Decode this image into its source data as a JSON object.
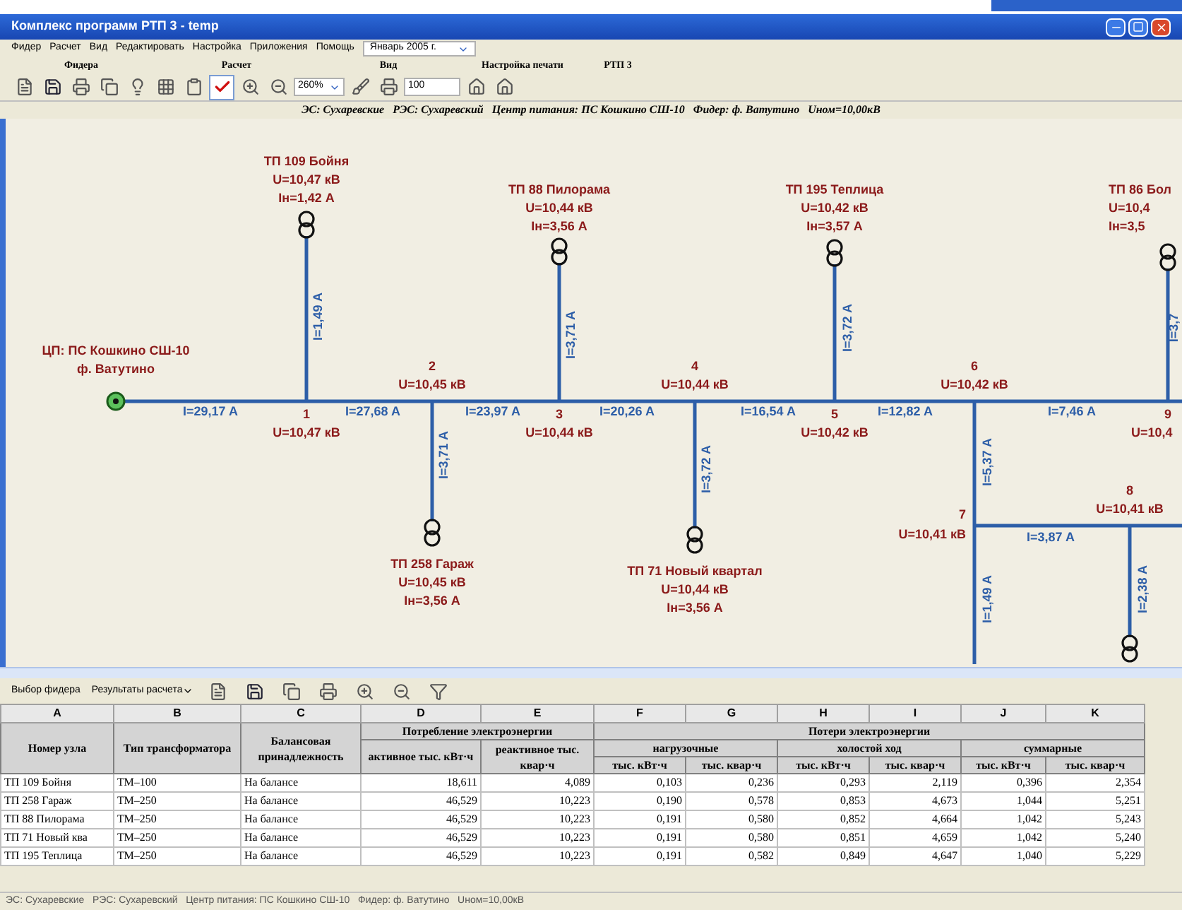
{
  "window": {
    "title": "Комплекс программ РТП 3 - temp"
  },
  "menu": [
    "Фидер",
    "Расчет",
    "Вид",
    "Редактировать",
    "Настройка",
    "Приложения",
    "Помощь"
  ],
  "period_select": "Январь 2005 г.",
  "toolbar_groups": [
    "Фидера",
    "Расчет",
    "Вид",
    "Настройка печати",
    "РТП 3"
  ],
  "zoom_select": "260%",
  "print_copies": "100",
  "info_bar": "ЭС: Сухаревские   РЭС: Сухаревский   Центр питания: ПС Кошкино СШ-10   Фидер: ф. Ватутино   Uном=10,00кВ",
  "diagram": {
    "source": [
      "ЦП: ПС Кошкино СШ-10",
      "ф. Ватутино"
    ],
    "transformers": [
      {
        "name": "ТП 109 Бойня",
        "voltage": "U=10,47 кВ",
        "current": "Iн=1,42 А"
      },
      {
        "name": "ТП 258 Гараж",
        "voltage": "U=10,45 кВ",
        "current": "Iн=3,56 А"
      },
      {
        "name": "ТП 88 Пилорама",
        "voltage": "U=10,44 кВ",
        "current": "Iн=3,56 А"
      },
      {
        "name": "ТП 71 Новый квартал",
        "voltage": "U=10,44 кВ",
        "current": "Iн=3,56 А"
      },
      {
        "name": "ТП 195 Теплица",
        "voltage": "U=10,42 кВ",
        "current": "Iн=3,57 А"
      },
      {
        "name": "ТП 86 Бол",
        "voltage": "U=10,4",
        "current": "Iн=3,5"
      }
    ],
    "nodes": [
      {
        "number": "1",
        "voltage": "U=10,47 кВ"
      },
      {
        "number": "2",
        "voltage": "U=10,45 кВ"
      },
      {
        "number": "3",
        "voltage": "U=10,44 кВ"
      },
      {
        "number": "4",
        "voltage": "U=10,44 кВ"
      },
      {
        "number": "5",
        "voltage": "U=10,42 кВ"
      },
      {
        "number": "6",
        "voltage": "U=10,42 кВ"
      },
      {
        "number": "9",
        "voltage": "U=10,4"
      },
      {
        "number": "8",
        "voltage": "U=10,41 кВ"
      },
      {
        "number": "7",
        "voltage": "U=10,41 кВ"
      }
    ],
    "currents": [
      "I=29,17 A",
      "I=1,49 A",
      "I=27,68 A",
      "I=3,71 A",
      "I=3,71 A",
      "I=23,97 A",
      "I=20,26 A",
      "I=3,72 A",
      "I=16,54 A",
      "I=3,72 A",
      "I=12,82 A",
      "I=5,37 A",
      "I=7,46 A",
      "I=3,7",
      "I=3,87 A",
      "I=1,49 A",
      "I=2,38 A"
    ]
  },
  "results_toolbar": {
    "feeder_button": "Выбор фидера",
    "results_menu": "Результаты расчета"
  },
  "table": {
    "column_letters": [
      "A",
      "B",
      "C",
      "D",
      "E",
      "F",
      "G",
      "H",
      "I",
      "J",
      "K"
    ],
    "headers": {
      "node": "Номер узла",
      "type": "Тип трансформатора",
      "balance": "Балансовая принадлежность",
      "consumption": "Потребление электроэнергии",
      "losses": "Потери электроэнергии",
      "active": "активное тыс. кВт·ч",
      "reactive": "реактивное тыс. квар·ч",
      "loss_groups": [
        "нагрузочные",
        "холостой ход",
        "суммарные"
      ],
      "units": [
        "тыс. кВт·ч",
        "тыс. квар·ч",
        "тыс. кВт·ч",
        "тыс. квар·ч",
        "тыс. кВт·ч",
        "тыс. квар·ч"
      ]
    },
    "rows": [
      [
        "ТП 109 Бойня",
        "ТМ–100",
        "На балансе",
        "18,611",
        "4,089",
        "0,103",
        "0,236",
        "0,293",
        "2,119",
        "0,396",
        "2,354"
      ],
      [
        "ТП 258 Гараж",
        "ТМ–250",
        "На балансе",
        "46,529",
        "10,223",
        "0,190",
        "0,578",
        "0,853",
        "4,673",
        "1,044",
        "5,251"
      ],
      [
        "ТП 88 Пилорама",
        "ТМ–250",
        "На балансе",
        "46,529",
        "10,223",
        "0,191",
        "0,580",
        "0,852",
        "4,664",
        "1,042",
        "5,243"
      ],
      [
        "ТП 71 Новый ква",
        "ТМ–250",
        "На балансе",
        "46,529",
        "10,223",
        "0,191",
        "0,580",
        "0,851",
        "4,659",
        "1,042",
        "5,240"
      ],
      [
        "ТП 195 Теплица",
        "ТМ–250",
        "На балансе",
        "46,529",
        "10,223",
        "0,191",
        "0,582",
        "0,849",
        "4,647",
        "1,040",
        "5,229"
      ]
    ]
  },
  "status_bar": "ЭС: Сухаревские   РЭС: Сухаревский   Центр питания: ПС Кошкино СШ-10   Фидер: ф. Ватутино   Uном=10,00кВ"
}
